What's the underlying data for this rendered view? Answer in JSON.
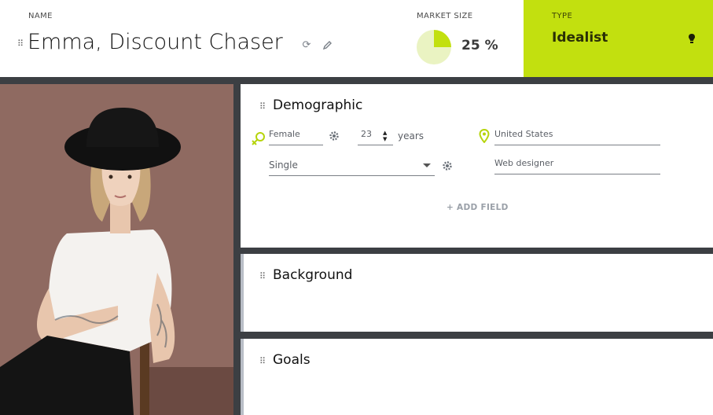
{
  "persona": {
    "name_label": "NAME",
    "name": "Emma, Discount Chaser",
    "market_label": "MARKET SIZE",
    "market_value": "25 %",
    "market_fraction": 0.25,
    "type_label": "TYPE",
    "type_value": "Idealist"
  },
  "icons": {
    "refresh": "refresh-icon",
    "edit": "pencil-icon",
    "bulb": "lightbulb-icon",
    "gender": "gender-icon",
    "location": "map-pin-icon",
    "settings": "gear-icon",
    "grip": "drag-handle-icon"
  },
  "colors": {
    "accent": "#c2e00f",
    "pie_fill": "#c2e00f",
    "pie_bg": "#eaf3c2"
  },
  "demographic": {
    "title": "Demographic",
    "gender": "Female",
    "age": "23",
    "age_unit": "years",
    "country": "United States",
    "status": "Single",
    "job": "Web designer",
    "add_field": "+ ADD FIELD"
  },
  "background": {
    "title": "Background"
  },
  "goals": {
    "title": "Goals"
  }
}
